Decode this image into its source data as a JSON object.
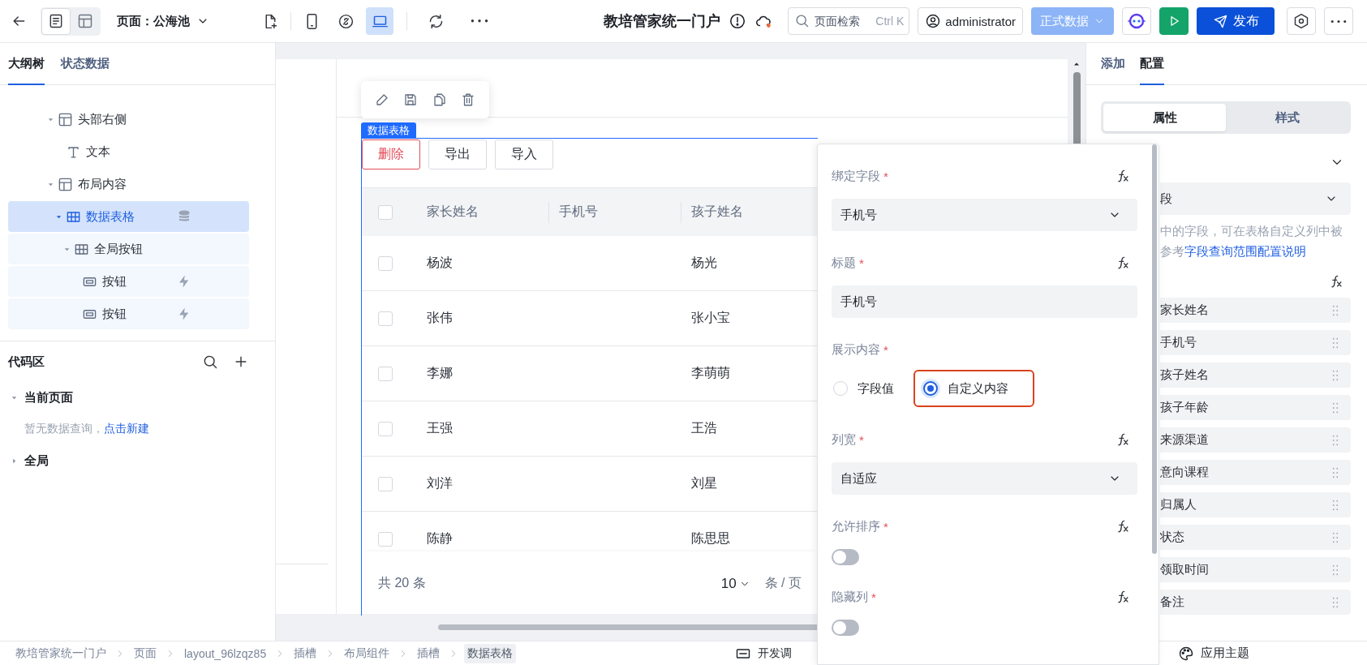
{
  "topbar": {
    "page_label": "页面：公海池",
    "views": [
      {
        "kind": "outline",
        "selected": true
      },
      {
        "kind": "layout",
        "selected": false
      }
    ],
    "devices": [
      {
        "kind": "mobile",
        "selected": false
      },
      {
        "kind": "link",
        "selected": false
      },
      {
        "kind": "laptop",
        "selected": true
      }
    ],
    "title": "教培管家统一门户",
    "search": {
      "placeholder": "页面检索",
      "shortcut": "Ctrl K"
    },
    "user": "administrator",
    "env": "正式数据",
    "publish": "发布"
  },
  "outline": {
    "tabs": [
      {
        "label": "大纲树",
        "selected": true
      },
      {
        "label": "状态数据",
        "selected": false
      }
    ],
    "tree": [
      {
        "label": "头部右侧",
        "kind": "layout",
        "expanded": true,
        "selected": false,
        "children": [
          {
            "label": "文本",
            "kind": "text",
            "selected": false
          }
        ]
      },
      {
        "label": "布局内容",
        "kind": "layout",
        "expanded": true,
        "selected": false,
        "children": [
          {
            "label": "数据表格",
            "kind": "table",
            "expanded": true,
            "selected": true,
            "children": [
              {
                "label": "全局按钮",
                "kind": "group",
                "expanded": true,
                "selected": false,
                "children": [
                  {
                    "label": "按钮",
                    "kind": "button",
                    "selected": false
                  },
                  {
                    "label": "按钮",
                    "kind": "button",
                    "selected": false
                  }
                ]
              }
            ]
          }
        ]
      }
    ]
  },
  "code_area": {
    "title": "代码区",
    "groups": [
      {
        "label": "当前页面",
        "expanded": true,
        "empty_text": "暂无数据查询，",
        "link": "点击新建"
      },
      {
        "label": "全局",
        "expanded": false
      }
    ]
  },
  "canvas": {
    "component_tag": "数据表格",
    "actions": [
      {
        "label": "删除",
        "kind": "danger"
      },
      {
        "label": "导出",
        "kind": "default"
      },
      {
        "label": "导入",
        "kind": "default"
      }
    ],
    "table": {
      "all_checked": false,
      "columns": [
        "家长姓名",
        "手机号",
        "孩子姓名"
      ],
      "rows": [
        {
          "parent": "杨波",
          "child": "杨光",
          "checked": false
        },
        {
          "parent": "张伟",
          "child": "张小宝",
          "checked": false
        },
        {
          "parent": "李娜",
          "child": "李萌萌",
          "checked": false
        },
        {
          "parent": "王强",
          "child": "王浩",
          "checked": false
        },
        {
          "parent": "刘洋",
          "child": "刘星",
          "checked": false
        },
        {
          "parent": "陈静",
          "child": "陈思思",
          "checked": false
        }
      ]
    },
    "footer": {
      "total": "共 20 条",
      "page_size": "10",
      "per_page": "条 / 页"
    }
  },
  "popover": {
    "fields": [
      {
        "kind": "select",
        "label": "绑定字段",
        "mark": "*",
        "formula": true,
        "value": "手机号"
      },
      {
        "kind": "input",
        "label": "标题",
        "mark": "*",
        "formula": true,
        "value": "手机号"
      },
      {
        "kind": "radio",
        "label": "展示内容",
        "mark": "*",
        "formula": false,
        "options": [
          {
            "label": "字段值",
            "selected": false,
            "highlighted": false
          },
          {
            "label": "自定义内容",
            "selected": true,
            "highlighted": true
          }
        ]
      },
      {
        "kind": "select",
        "label": "列宽",
        "mark": "*",
        "formula": true,
        "value": "自适应"
      },
      {
        "kind": "switch",
        "label": "允许排序",
        "mark": "*",
        "formula": true,
        "on": false
      },
      {
        "kind": "switch",
        "label": "隐藏列",
        "mark": "*",
        "formula": true,
        "on": false
      }
    ]
  },
  "settings": {
    "tabs": [
      {
        "label": "添加",
        "selected": false
      },
      {
        "label": "配置",
        "selected": true
      }
    ],
    "segments": [
      {
        "label": "属性",
        "selected": true
      },
      {
        "label": "样式",
        "selected": false
      }
    ],
    "field_value": "段",
    "help_line": "中的字段，可在表格自定义列中被",
    "help_prefix": "参考",
    "help_link": "字段查询范围配置说明",
    "columns": [
      "家长姓名",
      "手机号",
      "孩子姓名",
      "孩子年龄",
      "来源渠道",
      "意向课程",
      "归属人",
      "状态",
      "领取时间",
      "备注"
    ]
  },
  "bottom": {
    "breadcrumbs": [
      {
        "label": "教培管家统一门户",
        "selected": false
      },
      {
        "label": "页面",
        "selected": false
      },
      {
        "label": "layout_96lzqz85",
        "selected": false
      },
      {
        "label": "插槽",
        "selected": false
      },
      {
        "label": "布局组件",
        "selected": false
      },
      {
        "label": "插槽",
        "selected": false
      },
      {
        "label": "数据表格",
        "selected": true
      }
    ],
    "debug": "开发调",
    "theme": "应用主题"
  }
}
